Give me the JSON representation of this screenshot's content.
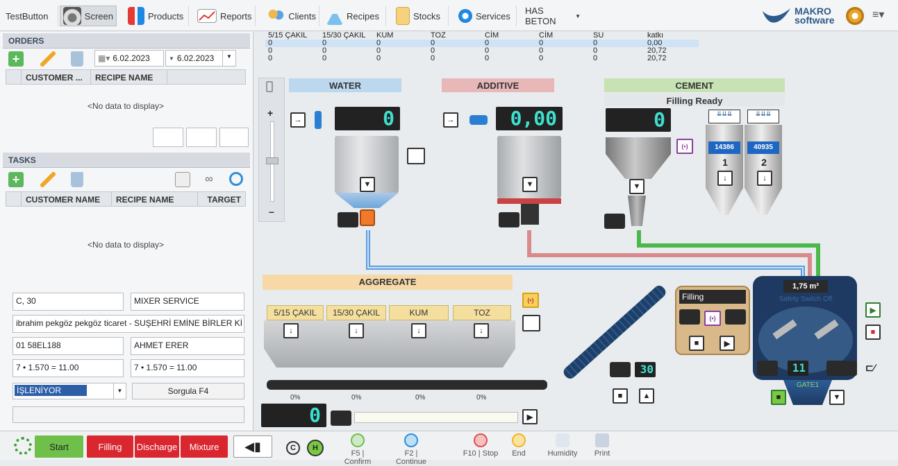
{
  "topbar": {
    "items": [
      {
        "label": "TestButton",
        "icon": "none"
      },
      {
        "label": "Screen",
        "icon": "gauge-icon"
      },
      {
        "label": "Products",
        "icon": "products-icon"
      },
      {
        "label": "Reports",
        "icon": "chart-icon"
      },
      {
        "label": "Clients",
        "icon": "people-icon"
      },
      {
        "label": "Recipes",
        "icon": "flask-icon"
      },
      {
        "label": "Stocks",
        "icon": "box-icon"
      },
      {
        "label": "Services",
        "icon": "services-icon"
      },
      {
        "label": "HAS BETON",
        "icon": "dropdown"
      }
    ],
    "brand_top": "MAKRO",
    "brand_bottom": "software"
  },
  "orders": {
    "title": "ORDERS",
    "date_from": "6.02.2023",
    "date_to": "6.02.2023",
    "columns": [
      "CUSTOMER ...",
      "RECIPE NAME"
    ],
    "empty": "<No data to display>"
  },
  "tasks": {
    "title": "TASKS",
    "columns": [
      "CUSTOMER NAME",
      "RECIPE NAME",
      "TARGET"
    ],
    "empty": "<No data to display>"
  },
  "details": {
    "f1": "C, 30",
    "f2": "MIXER SERVICE",
    "f3": "ibrahim pekgöz pekgöz ticaret - SUŞEHRİ EMİNE BİRLER Kİ",
    "f4": "01 58EL188",
    "f5": "AHMET ERER",
    "f6": "7 • 1.570 = 11.00",
    "f7": "7 • 1.570 = 11.00",
    "status": "İŞLENİYOR",
    "query": "Sorgula   F4"
  },
  "materials": {
    "headers": [
      "5/15 ÇAKIL",
      "15/30 ÇAKIL",
      "KUM",
      "TOZ",
      "CİM",
      "CİM",
      "SU",
      "katkı"
    ],
    "rows": [
      [
        "0",
        "0",
        "0",
        "0",
        "0",
        "0",
        "0",
        "0,00"
      ],
      [
        "0",
        "0",
        "0",
        "0",
        "0",
        "0",
        "0",
        "20,72"
      ],
      [
        "0",
        "0",
        "0",
        "0",
        "0",
        "0",
        "0",
        "20,72"
      ]
    ]
  },
  "water": {
    "title": "WATER",
    "value": "0"
  },
  "additive": {
    "title": "ADDITIVE",
    "value": "0,00"
  },
  "cement": {
    "title": "CEMENT",
    "status": "Filling Ready",
    "value": "0",
    "silo1_value": "14386",
    "silo2_value": "40935",
    "silo1_no": "1",
    "silo2_no": "2"
  },
  "aggregate": {
    "title": "AGGREGATE",
    "bins": [
      {
        "label": "5/15 ÇAKIL",
        "pct": "0%"
      },
      {
        "label": "15/30 ÇAKIL",
        "pct": "0%"
      },
      {
        "label": "KUM",
        "pct": "0%"
      },
      {
        "label": "TOZ",
        "pct": "0%"
      }
    ],
    "value": "0"
  },
  "conveyor": {
    "value": "30"
  },
  "mixer": {
    "volume": "1,75 m³",
    "status": "Filling",
    "count": "11",
    "gate": "GATE1",
    "overlay": "Safety Switch Off"
  },
  "bottom": {
    "start": "Start",
    "filling": "Filling",
    "discharge": "Discharge",
    "mixture": "Mixture",
    "confirm": "F5 | Confirm",
    "continue": "F2 | Continue",
    "stop": "F10 | Stop",
    "end": "End",
    "humidity": "Humidity",
    "print": "Print"
  },
  "colors": {
    "start": "#3aa335",
    "red": "#d9262f",
    "water_band": "#bcd8ef",
    "additive_band": "#e8b7b8",
    "cement_band": "#c7e3b4",
    "aggregate_band": "#f7d9a8",
    "segment": "#3ee0d0"
  }
}
